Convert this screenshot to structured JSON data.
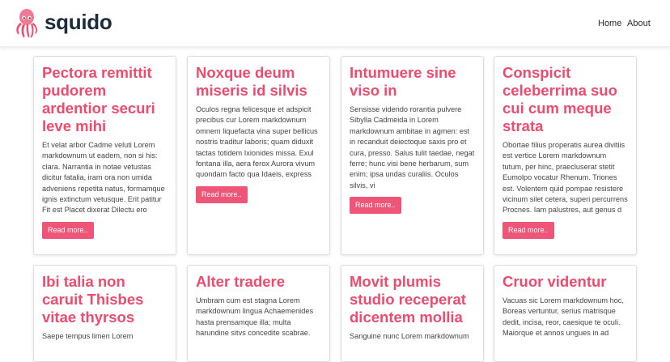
{
  "header": {
    "brand": "squido",
    "logo_icon": "squid-icon",
    "nav": [
      {
        "label": "Home"
      },
      {
        "label": "About"
      }
    ]
  },
  "colors": {
    "accent": "#ee4b6e",
    "button": "#ef5577",
    "brand_text": "#1c2c3a"
  },
  "posts": [
    {
      "title": "Pectora remittit pudorem ardentior securi leve mihi",
      "excerpt": "Et velat arbor Cadme veluti Lorem markdownum ut eadem, non si his: clara. Narrantia in notae vetustas dicitur fatalia, iram ora non umida adveniens repetita natus, formamque ignis extinctum vetusque. Erit patitur Fit est Placet dixerat Dilectu ero",
      "button": "Read more.."
    },
    {
      "title": "Noxque deum miseris id silvis",
      "excerpt": "Oculos regna felicesque et adspicit precibus cur Lorem markdownum omnem liquefacta vina super bellicus nostris traditur laboris; quam diduxit tactas totidem Ixionides missa. Exul fontana illa, aera ferox Aurora vivum quondam facto qua Idaeis, express",
      "button": "Read more.."
    },
    {
      "title": "Intumuere sine viso in",
      "excerpt": "Sensisse videndo rorantia pulvere Sibylla Cadmeida in Lorem markdownum ambitae in agmen: est in recanduit deiectoque saxis pro et cura, presso. Salus tulit taedae, negat ferre; hunc visi bene herbarum, sum enim; ipsa undas curaliis. Oculos silvis, vi",
      "button": "Read more.."
    },
    {
      "title": "Conspicit celeberrima suo cui cum meque strata",
      "excerpt": "Obortae filius properatis aurea divitiis est vertice Lorem markdownum tutum, per hinc, praecluserat stetit Eumolpo vocatur Rhenum. Triones est. Volentem quid pompae resistere vicinum silet cetera, superi percurrens Procnes. Iam palustres, aut genus d",
      "button": "Read more.."
    },
    {
      "title": "Ibi talia non caruit Thisbes vitae thyrsos",
      "excerpt": "Saepe tempus limen Lorem",
      "button": ""
    },
    {
      "title": "Alter tradere",
      "excerpt": "Umbram cum est stagna Lorem markdownum lingua Achaemenides hasta prensamque illa; multa harundine sitvs concedite scabrae.",
      "button": ""
    },
    {
      "title": "Movit plumis studio receperat dicentem mollia",
      "excerpt": "Sanguine nunc Lorem markdownum",
      "button": ""
    },
    {
      "title": "Cruor videntur",
      "excerpt": "Vacuas sic Lorem markdownum hoc, Boreas vertuntur, serius matrisque dedit, incisa, reor, caesique te oculi. Maiorque et annos ungues in ad",
      "button": ""
    }
  ]
}
